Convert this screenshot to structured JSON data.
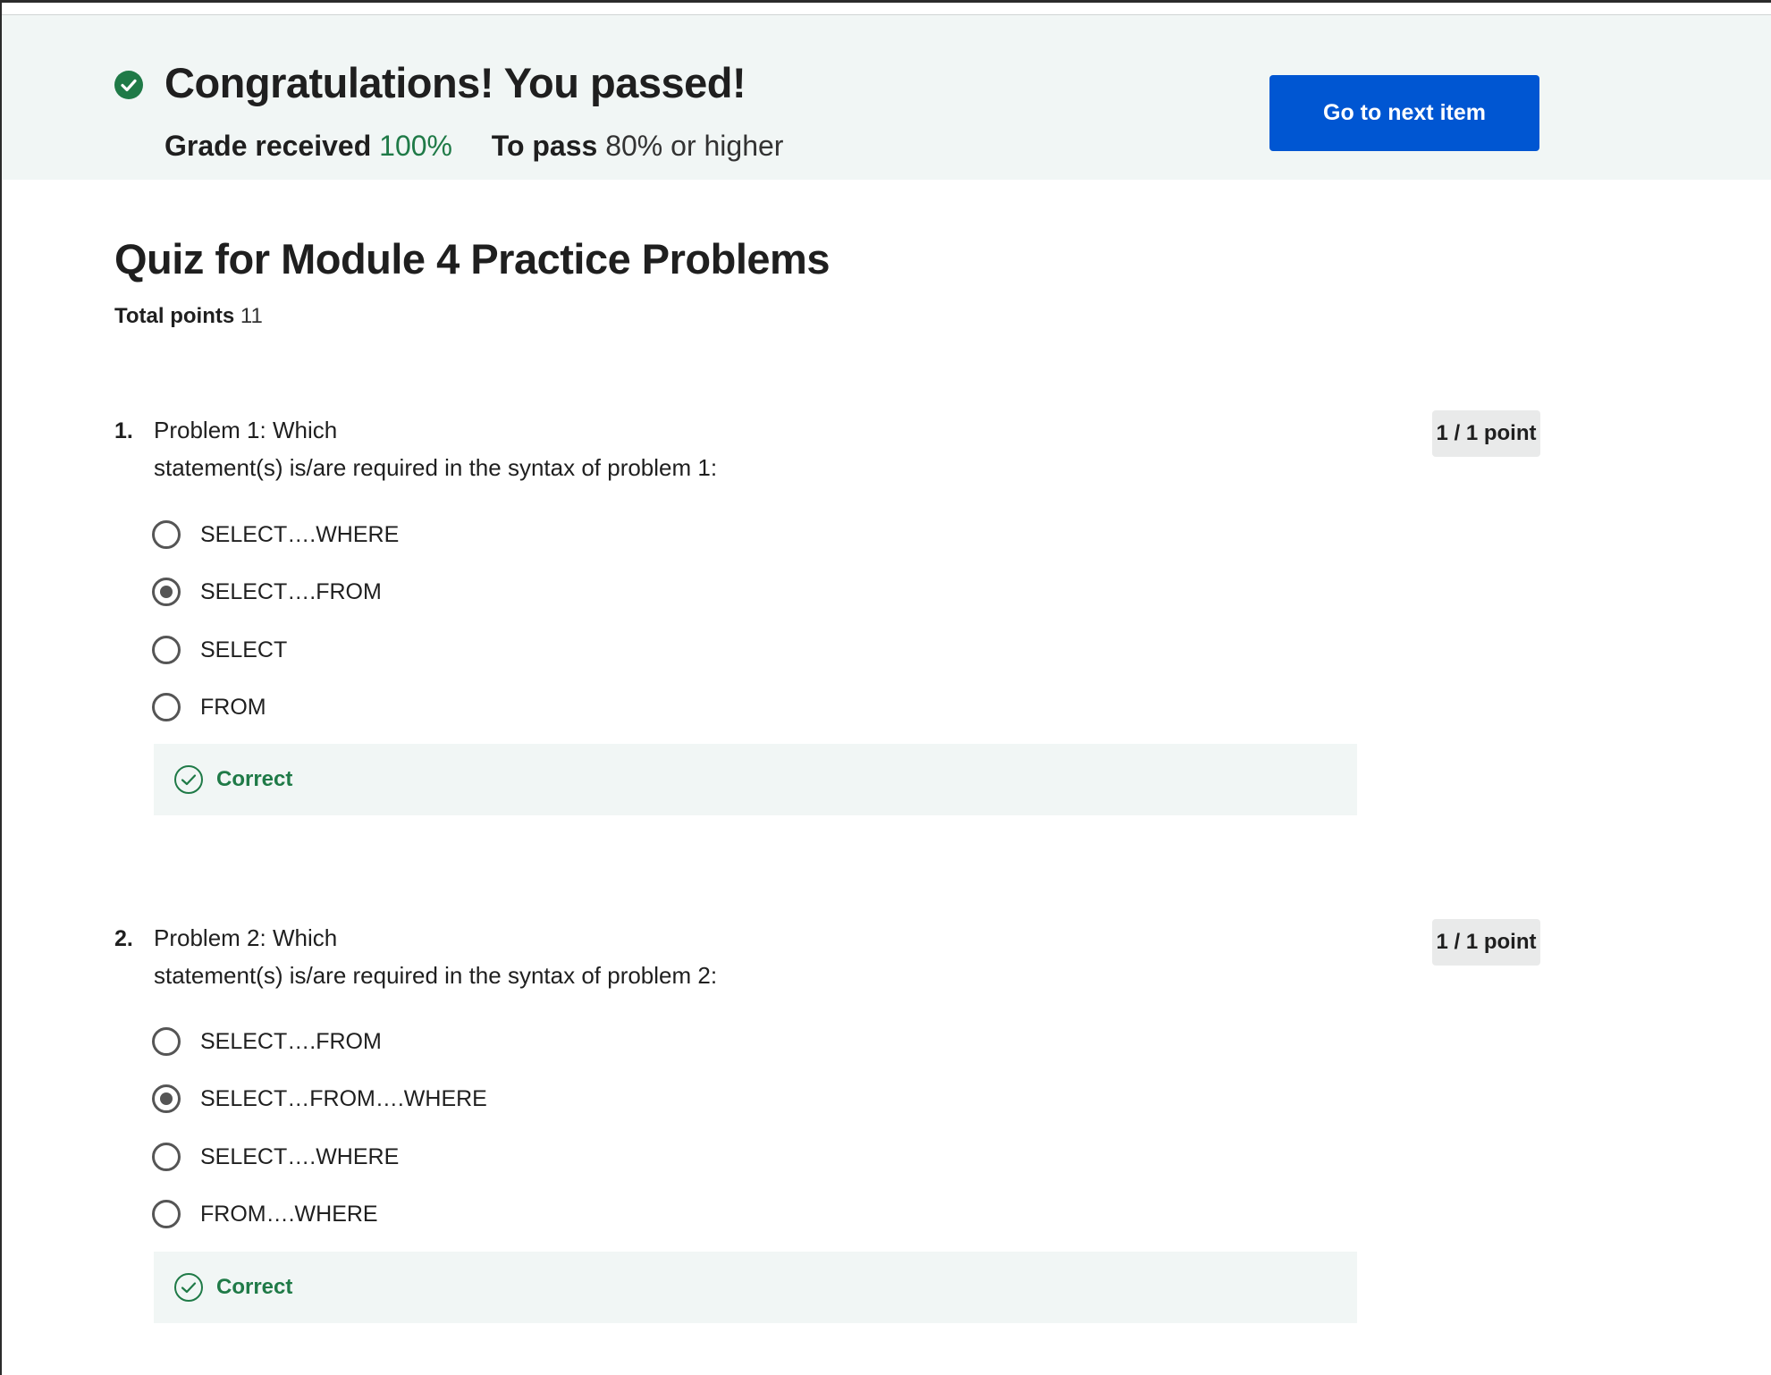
{
  "banner": {
    "title": "Congratulations! You passed!",
    "grade_label": "Grade received",
    "grade_value": "100%",
    "pass_label": "To pass",
    "pass_value": "80% or higher",
    "next_button": "Go to next item"
  },
  "quiz": {
    "title": "Quiz for Module 4 Practice Problems",
    "total_points_label": "Total points",
    "total_points_value": "11",
    "questions": [
      {
        "number": "1.",
        "text_line1": "Problem 1: Which",
        "text_line2": "statement(s) is/are required in the syntax of problem 1:",
        "points": "1 / 1 point",
        "options": [
          "SELECT….WHERE",
          "SELECT….FROM",
          "SELECT",
          "FROM"
        ],
        "selected_index": 1,
        "feedback": "Correct"
      },
      {
        "number": "2.",
        "text_line1": "Problem 2: Which",
        "text_line2": "statement(s) is/are required in the syntax of problem 2:",
        "points": "1 / 1 point",
        "options": [
          "SELECT….FROM",
          "SELECT…FROM….WHERE",
          "SELECT….WHERE",
          "FROM….WHERE"
        ],
        "selected_index": 1,
        "feedback": "Correct"
      }
    ]
  },
  "colors": {
    "accent_blue": "#0056d2",
    "success_green": "#1f7a47",
    "banner_bg": "#f1f6f5"
  }
}
